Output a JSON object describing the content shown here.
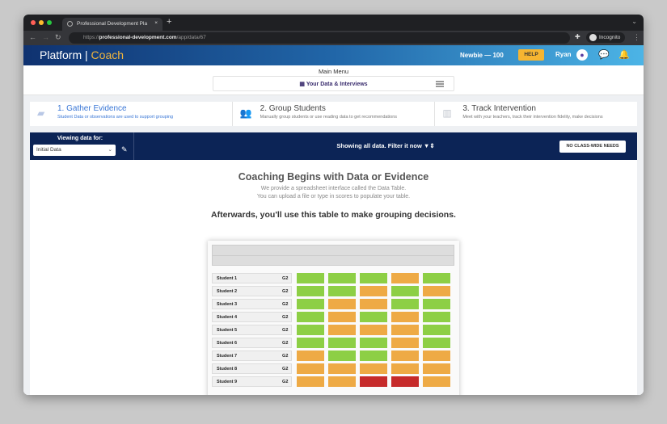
{
  "browser": {
    "tab_title": "Professional Development Pla",
    "tab_close": "×",
    "new_tab": "+",
    "url_prefix": "https://",
    "url_domain": "professional-development.com",
    "url_path": "/app/data/67",
    "incognito": "Incognito"
  },
  "header": {
    "brand": "Platform",
    "brand_sep": " | ",
    "brand_accent": "Coach",
    "level": "Newbie — 100",
    "help": "HELP",
    "user": "Ryan"
  },
  "main_menu": {
    "title": "Main Menu",
    "selected": "Your Data & Interviews"
  },
  "steps": [
    {
      "title": "1. Gather Evidence",
      "desc": "Student Data or observations are used to support grouping"
    },
    {
      "title": "2. Group Students",
      "desc": "Manually group students or use reading data to get recommendations"
    },
    {
      "title": "3. Track Intervention",
      "desc": "Meet with your teachers, track their intervention fidelity, make decisions"
    }
  ],
  "toolbar": {
    "viewing_label": "Viewing data for:",
    "viewing_value": "Initial Data",
    "filter_text": "Showing all data. Filter it now",
    "no_class_wide": "NO CLASS-WIDE NEEDS"
  },
  "intro": {
    "title": "Coaching Begins with Data or Evidence",
    "line1": "We provide a spreadsheet interface called the Data Table.",
    "line2": "You can upload a file or type in scores to populate your table.",
    "line3": "Afterwards, you'll use this table to make grouping decisions."
  },
  "colors": {
    "green": "#8dcf45",
    "orange": "#eeaa45",
    "red": "#c62a2a"
  },
  "table": {
    "rows": [
      {
        "name": "Student 1",
        "grade": "G2",
        "cells": [
          "g",
          "g",
          "g",
          "o",
          "g"
        ]
      },
      {
        "name": "Student 2",
        "grade": "G2",
        "cells": [
          "g",
          "g",
          "o",
          "g",
          "o"
        ]
      },
      {
        "name": "Student 3",
        "grade": "G2",
        "cells": [
          "g",
          "o",
          "o",
          "g",
          "g"
        ]
      },
      {
        "name": "Student 4",
        "grade": "G2",
        "cells": [
          "g",
          "o",
          "g",
          "o",
          "g"
        ]
      },
      {
        "name": "Student 5",
        "grade": "G2",
        "cells": [
          "g",
          "o",
          "o",
          "o",
          "g"
        ]
      },
      {
        "name": "Student 6",
        "grade": "G2",
        "cells": [
          "g",
          "g",
          "g",
          "o",
          "g"
        ]
      },
      {
        "name": "Student 7",
        "grade": "G2",
        "cells": [
          "o",
          "g",
          "g",
          "o",
          "o"
        ]
      },
      {
        "name": "Student 8",
        "grade": "G2",
        "cells": [
          "o",
          "o",
          "o",
          "o",
          "o"
        ]
      },
      {
        "name": "Student 9",
        "grade": "G2",
        "cells": [
          "o",
          "o",
          "r",
          "r",
          "o"
        ]
      }
    ]
  }
}
